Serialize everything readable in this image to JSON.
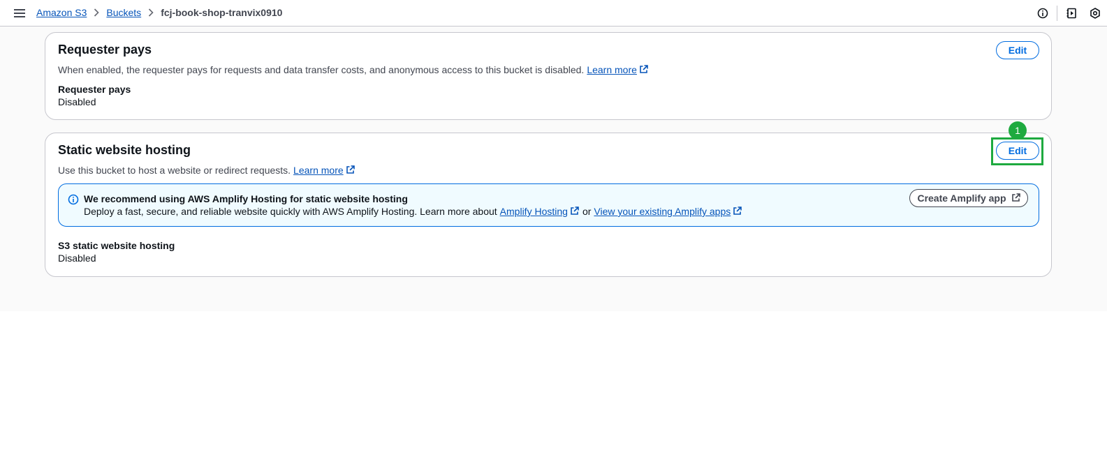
{
  "topbar": {
    "menu_icon": "hamburger-menu-icon",
    "breadcrumb": [
      {
        "label": "Amazon S3"
      },
      {
        "label": "Buckets"
      },
      {
        "label": "fcj-book-shop-tranvix0910"
      }
    ],
    "right_icons": [
      "info-icon",
      "notes-panel-icon",
      "settings-hex-icon"
    ]
  },
  "requester_pays": {
    "title": "Requester pays",
    "description": "When enabled, the requester pays for requests and data transfer costs, and anonymous access to this bucket is disabled.",
    "learn_more": "Learn more",
    "edit_label": "Edit",
    "field_label": "Requester pays",
    "field_value": "Disabled"
  },
  "static_hosting": {
    "title": "Static website hosting",
    "description": "Use this bucket to host a website or redirect requests.",
    "learn_more": "Learn more",
    "edit_label": "Edit",
    "step_badge": "1",
    "alert": {
      "title": "We recommend using AWS Amplify Hosting for static website hosting",
      "text": "Deploy a fast, secure, and reliable website quickly with AWS Amplify Hosting. Learn more about",
      "link1": "Amplify Hosting",
      "or_text": "or",
      "link2": "View your existing Amplify apps",
      "button": "Create Amplify app"
    },
    "field_label": "S3 static website hosting",
    "field_value": "Disabled"
  },
  "colors": {
    "link": "#0654b9",
    "primary": "#006ce0",
    "highlight": "#1eaa3f",
    "alert_bg": "#f0fbff"
  }
}
